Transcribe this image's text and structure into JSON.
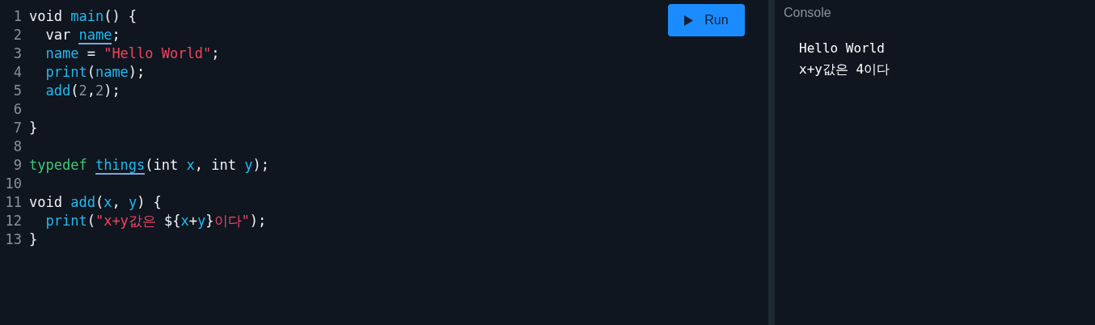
{
  "editor": {
    "lines": [
      {
        "number": "1",
        "tokens": [
          {
            "t": "void ",
            "kind": "plain"
          },
          {
            "t": "main",
            "kind": "ident"
          },
          {
            "t": "() {",
            "kind": "plain"
          }
        ]
      },
      {
        "number": "2",
        "tokens": [
          {
            "t": "  var ",
            "kind": "plain"
          },
          {
            "t": "name",
            "kind": "flagged"
          },
          {
            "t": ";",
            "kind": "plain"
          }
        ]
      },
      {
        "number": "3",
        "tokens": [
          {
            "t": "  name",
            "kind": "ident"
          },
          {
            "t": " = ",
            "kind": "plain"
          },
          {
            "t": "\"Hello World\"",
            "kind": "string"
          },
          {
            "t": ";",
            "kind": "plain"
          }
        ]
      },
      {
        "number": "4",
        "tokens": [
          {
            "t": "  print",
            "kind": "ident"
          },
          {
            "t": "(",
            "kind": "plain"
          },
          {
            "t": "name",
            "kind": "ident"
          },
          {
            "t": ");",
            "kind": "plain"
          }
        ]
      },
      {
        "number": "5",
        "tokens": [
          {
            "t": "  add",
            "kind": "ident"
          },
          {
            "t": "(",
            "kind": "plain"
          },
          {
            "t": "2",
            "kind": "number"
          },
          {
            "t": ",",
            "kind": "plain"
          },
          {
            "t": "2",
            "kind": "number"
          },
          {
            "t": ");",
            "kind": "plain"
          }
        ]
      },
      {
        "number": "6"
      },
      {
        "number": "7",
        "tokens": [
          {
            "t": "}",
            "kind": "plain"
          }
        ]
      },
      {
        "number": "8"
      },
      {
        "number": "9",
        "tokens": [
          {
            "t": "typedef ",
            "kind": "keyword"
          },
          {
            "t": "things",
            "kind": "flagged"
          },
          {
            "t": "(int ",
            "kind": "plain"
          },
          {
            "t": "x",
            "kind": "ident"
          },
          {
            "t": ", int ",
            "kind": "plain"
          },
          {
            "t": "y",
            "kind": "ident"
          },
          {
            "t": ");",
            "kind": "plain"
          }
        ]
      },
      {
        "number": "10"
      },
      {
        "number": "11",
        "tokens": [
          {
            "t": "void ",
            "kind": "plain"
          },
          {
            "t": "add",
            "kind": "ident"
          },
          {
            "t": "(",
            "kind": "plain"
          },
          {
            "t": "x",
            "kind": "ident"
          },
          {
            "t": ", ",
            "kind": "plain"
          },
          {
            "t": "y",
            "kind": "ident"
          },
          {
            "t": ") {",
            "kind": "plain"
          }
        ]
      },
      {
        "number": "12",
        "tokens": [
          {
            "t": "  print",
            "kind": "ident"
          },
          {
            "t": "(",
            "kind": "plain"
          },
          {
            "t": "\"x+y값은 ",
            "kind": "string"
          },
          {
            "t": "${",
            "kind": "plain"
          },
          {
            "t": "x",
            "kind": "ident"
          },
          {
            "t": "+",
            "kind": "plain"
          },
          {
            "t": "y",
            "kind": "ident"
          },
          {
            "t": "}",
            "kind": "plain"
          },
          {
            "t": "이다\"",
            "kind": "string"
          },
          {
            "t": ");",
            "kind": "plain"
          }
        ]
      },
      {
        "number": "13",
        "tokens": [
          {
            "t": "}",
            "kind": "plain"
          }
        ]
      }
    ]
  },
  "run_button": {
    "label": "Run"
  },
  "console": {
    "title": "Console",
    "output": [
      "Hello World",
      "x+y값은 4이다"
    ]
  }
}
